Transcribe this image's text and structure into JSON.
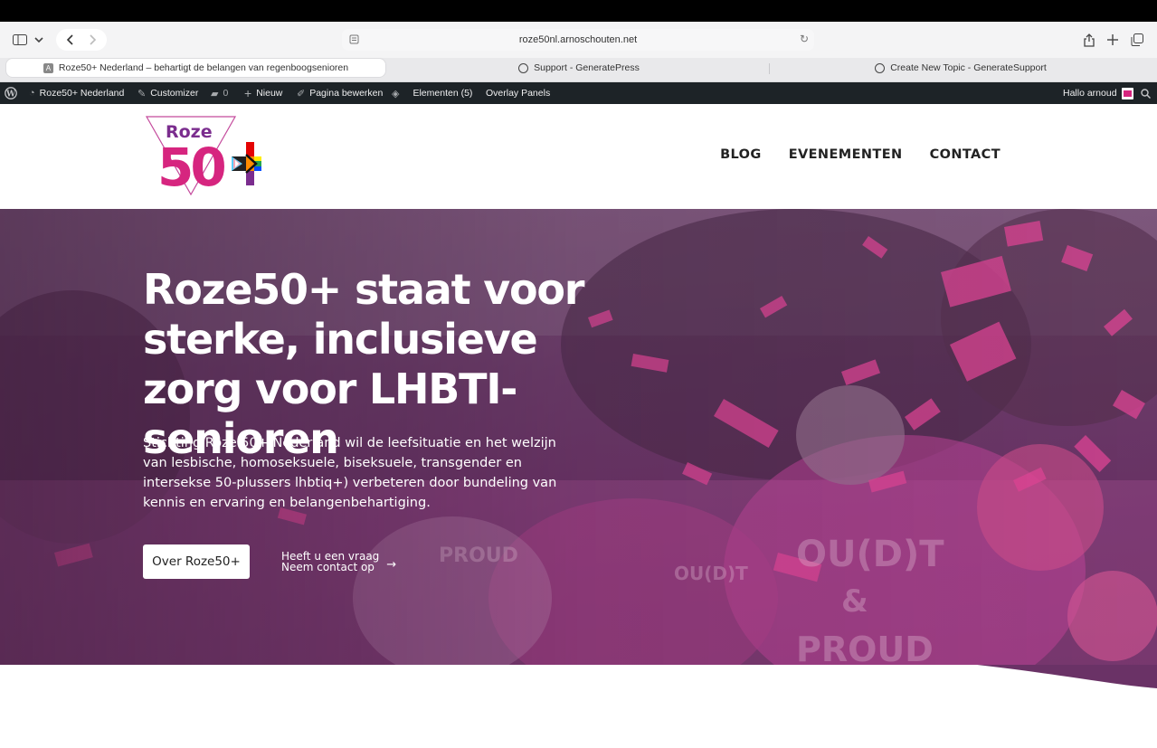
{
  "browser": {
    "url": "roze50nl.arnoschouten.net",
    "tabs": [
      {
        "label": "Roze50+ Nederland – behartigt de belangen van regenboogsenioren",
        "favicon": "A",
        "active": true
      },
      {
        "label": "Support - GeneratePress",
        "active": false
      },
      {
        "label": "Create New Topic - GenerateSupport",
        "active": false
      }
    ]
  },
  "adminbar": {
    "site": "Roze50+ Nederland",
    "customizer": "Customizer",
    "comments": "0",
    "new": "Nieuw",
    "edit": "Pagina bewerken",
    "elements": "Elementen (5)",
    "overlay": "Overlay Panels",
    "greeting": "Hallo arnoud"
  },
  "site": {
    "logo_text": "Roze",
    "logo_number": "50",
    "nav": [
      "BLOG",
      "EVENEMENTEN",
      "CONTACT"
    ]
  },
  "hero": {
    "title": "Roze50+ staat voor sterke, inclusieve zorg voor LHBTI-senioren",
    "text": "Stichting Roze 50+ Nederland wil de leefsituatie en het welzijn van lesbische, homoseksuele, biseksuele, transgender en intersekse 50-plussers lhbtiq+) verbeteren door bundeling van kennis en ervaring en belangenbehartiging.",
    "button": "Over Roze50+",
    "link_line1": "Heeft u een vraag",
    "link_line2": "Neem contact op",
    "arrow": "→"
  },
  "colors": {
    "brand_pink": "#d6257f",
    "brand_purple": "#7b2d8e",
    "admin_bg": "#1d2327"
  }
}
